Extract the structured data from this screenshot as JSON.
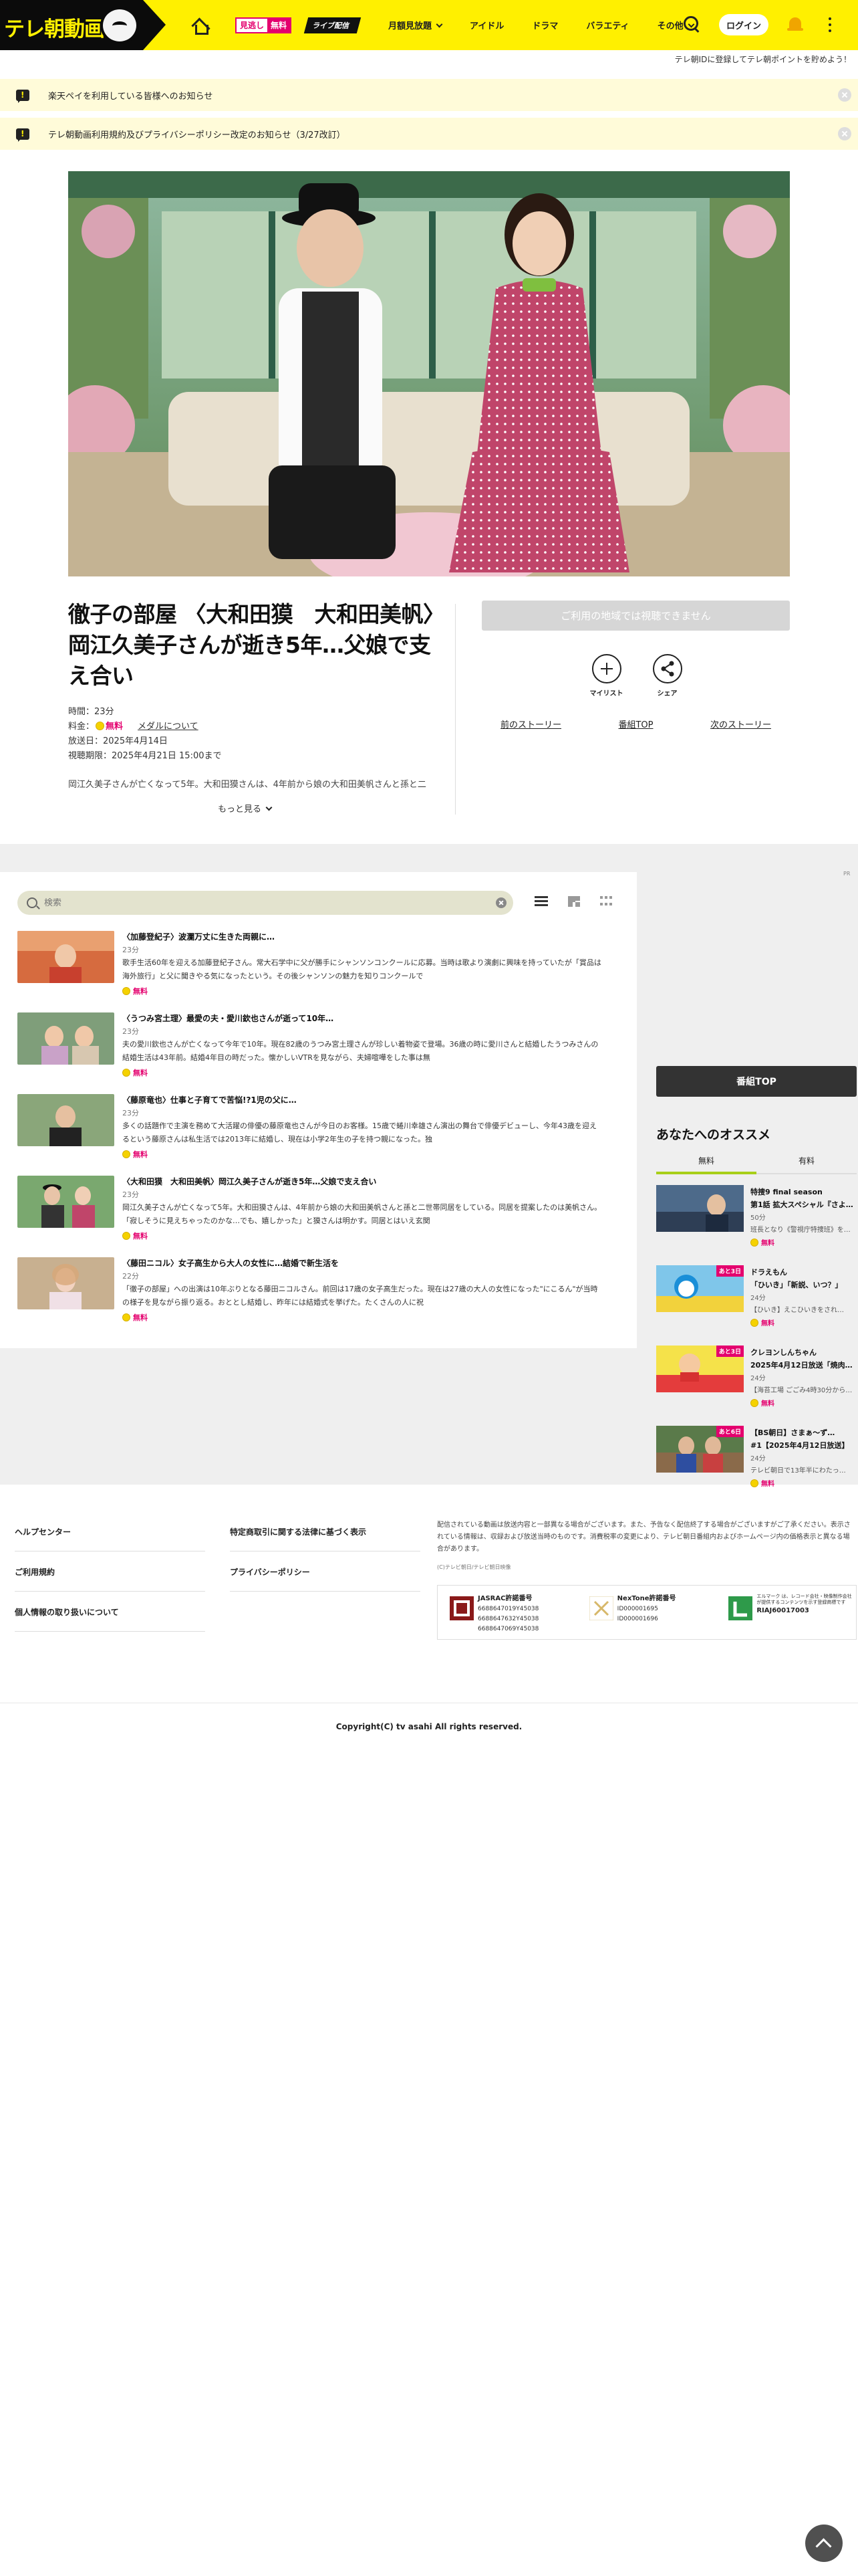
{
  "header": {
    "logo_text": "テレ朝動画",
    "free_badge": {
      "left": "見逃し",
      "right": "無料"
    },
    "live_badge": "ライブ配信",
    "nav": [
      "月額見放題",
      "アイドル",
      "ドラマ",
      "バラエティ",
      "その他"
    ],
    "login_label": "ログイン"
  },
  "promo_text": "テレ朝IDに登録してテレ朝ポイントを貯めよう！",
  "notices": [
    "楽天ペイを利用している皆様へのお知らせ",
    "テレ朝動画利用規約及びプライバシーポリシー改定のお知らせ（3/27改訂）"
  ],
  "episode": {
    "title": "徹子の部屋 〈大和田獏　大和田美帆〉岡江久美子さんが逝き5年…父娘で支え合い",
    "duration": "時間：23分",
    "price_label": "料金：",
    "price_value": "無料",
    "medal_link": "メダルについて",
    "broadcast_date": "放送日：2025年4月14日",
    "deadline": "視聴期限：2025年4月21日 15:00まで",
    "description": "岡江久美子さんが亡くなって5年。大和田獏さんは、4年前から娘の大和田美帆さんと孫と二",
    "more_label": "もっと見る",
    "play_label": "ご利用の地域では視聴できません",
    "mylist_label": "マイリスト",
    "share_label": "シェア",
    "prev_story": "前のストーリー",
    "program_top": "番組TOP",
    "next_story": "次のストーリー"
  },
  "ad_mark": "PR",
  "list": {
    "search_placeholder": "検索",
    "items": [
      {
        "title": "〈加藤登紀子〉波瀾万丈に生きた両親に…",
        "duration": "23分",
        "summary": "歌手生活60年を迎える加藤登紀子さん。常大石学中に父が勝手にシャンソンコンクールに応募。当時は歌より演劇に興味を持っていたが「賞品は海外旅行」と父に聞きやる気になったという。その後シャンソンの魅力を知りコンクールで",
        "free": "無料"
      },
      {
        "title": "〈うつみ宮土理〉最愛の夫・愛川欽也さんが逝って10年…",
        "duration": "23分",
        "summary": "夫の愛川欽也さんが亡くなって今年で10年。現在82歳のうつみ宮土理さんが珍しい着物姿で登場。36歳の時に愛川さんと結婚したうつみさんの結婚生活は43年前。結婚4年目の時だった。懐かしいVTRを見ながら、夫婦喧嘩をした事は無",
        "free": "無料"
      },
      {
        "title": "〈藤原竜也〉仕事と子育てで苦悩!?1児の父に…",
        "duration": "23分",
        "summary": "多くの話題作で主演を務めて大活躍の俳優の藤原竜也さんが今日のお客様。15歳で蜷川幸雄さん演出の舞台で俳優デビューし、今年43歳を迎えるという藤原さんは私生活では2013年に結婚し、現在は小学2年生の子を持つ親になった。独",
        "free": "無料"
      },
      {
        "title": "〈大和田獏　大和田美帆〉岡江久美子さんが逝き5年…父娘で支え合い",
        "duration": "23分",
        "summary": "岡江久美子さんが亡くなって5年。大和田獏さんは、4年前から娘の大和田美帆さんと孫と二世帯同居をしている。同居を提案したのは美帆さん。「寂しそうに見えちゃったのかな…でも、嬉しかった」と獏さんは明かす。同居とはいえ玄関",
        "free": "無料"
      },
      {
        "title": "〈藤田ニコル〉女子高生から大人の女性に…結婚で新生活を",
        "duration": "22分",
        "summary": "「徹子の部屋」への出演は10年ぶりとなる藤田ニコルさん。前回は17歳の女子高生だった。現在は27歳の大人の女性になった\"にこるん\"が当時の様子を見ながら振り返る。おととし結婚し、昨年には結婚式を挙げた。たくさんの人に祝",
        "free": "無料"
      }
    ]
  },
  "sidebar": {
    "program_top_button": "番組TOP",
    "heading": "あなたへのオススメ",
    "tabs": [
      "無料",
      "有料"
    ],
    "items": [
      {
        "title": "特捜9 final season",
        "title2": "第1話 拡大スペシャル『さよ…",
        "duration": "50分",
        "summary": "班長となり《警視庁特捜班》を…",
        "free": "無料",
        "tag": ""
      },
      {
        "title": "ドラえもん",
        "title2": "「ひいき」「新説、いつ？」",
        "duration": "24分",
        "summary": "【ひいき】えこひいきをされ…",
        "free": "無料",
        "tag": "あと3日"
      },
      {
        "title": "クレヨンしんちゃん",
        "title2": "2025年4月12日放送「焼肉…",
        "duration": "24分",
        "summary": "【海苔工場 ごごみ4時30分から…",
        "free": "無料",
        "tag": "あと3日"
      },
      {
        "title": "【BS朝日】さまぁ～ず…",
        "title2": "#1【2025年4月12日放送】",
        "duration": "24分",
        "summary": "テレビ朝日で13年半にわたっ…",
        "free": "無料",
        "tag": "あと6日"
      }
    ]
  },
  "footer": {
    "links": [
      "ヘルプセンター",
      "特定商取引に関する法律に基づく表示",
      "ご利用規約",
      "プライバシーポリシー",
      "個人情報の取り扱いについて"
    ],
    "note": "配信されている動画は放送内容と一部異なる場合がございます。また、予告なく配信終了する場合がございますがご了承ください。表示されている情報は、収録および放送当時のものです。消費税率の変更により、テレビ朝日番組内およびホームページ内の価格表示と異なる場合があります。",
    "small_copy": "(C)テレビ朝日/テレビ朝日映像",
    "license1": {
      "title": "JASRAC許諾番号",
      "codes": [
        "6688647019Y45038",
        "6688647632Y45038",
        "6688647069Y45038"
      ]
    },
    "license2": {
      "title": "NexTone許諾番号",
      "codes": [
        "ID000001695",
        "ID000001696"
      ]
    },
    "license3": {
      "note": "エルマーク は、レコード会社・映像制作会社が提供するコンテンツを示す登録商標です",
      "code": "RIAJ60017003"
    }
  },
  "copyright": "Copyright(C) tv asahi All rights reserved."
}
